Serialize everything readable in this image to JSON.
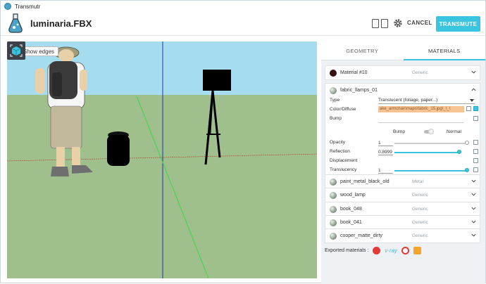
{
  "window": {
    "title": "Transmutr"
  },
  "header": {
    "filename": "luminaria.FBX",
    "cancel_label": "CANCEL",
    "transmute_label": "TRANSMUTE"
  },
  "viewport": {
    "show_edges_label": "Show edges",
    "show_edges_checked": false
  },
  "panel": {
    "tabs": [
      {
        "label": "GEOMETRY",
        "active": false
      },
      {
        "label": "MATERIALS",
        "active": true
      }
    ],
    "materials": [
      {
        "name": "Material #10",
        "type": "Generic",
        "swatch": "#3a0f10",
        "expanded": false
      },
      {
        "name": "fabric_llamps_01",
        "type": "",
        "swatch": "#6f8d6f",
        "expanded": true
      },
      {
        "name": "paint_metal_black_old",
        "type": "Metal",
        "swatch": "#557055",
        "expanded": false
      },
      {
        "name": "wood_lamp",
        "type": "Generic",
        "swatch": "#557055",
        "expanded": false
      },
      {
        "name": "book_048",
        "type": "Generic",
        "swatch": "#557055",
        "expanded": false
      },
      {
        "name": "book_041",
        "type": "Generic",
        "swatch": "#557055",
        "expanded": false
      },
      {
        "name": "cooper_matte_dirty",
        "type": "Generic",
        "swatch": "#557055",
        "expanded": false
      }
    ],
    "props": {
      "type_label": "Type",
      "type_value": "Translucent (foliage, paper...)",
      "diffuse_label": "Color/Diffuse",
      "diffuse_value": "ake_armchair\\maps\\fabric_15.jpg\\_\\_\\",
      "bump_label": "Bump",
      "bump_toggle_left": "Bump",
      "bump_toggle_right": "Normal",
      "opacity_label": "Opacity",
      "opacity_value": "1",
      "reflection_label": "Reflection",
      "reflection_value": "0.8999",
      "displacement_label": "Displacement",
      "translucency_label": "Translucency",
      "translucency_value": "1"
    },
    "exported_label": "Exported materials :",
    "exporters": [
      "sketchup-icon",
      "vray-icon",
      "thea-icon",
      "enscape-icon"
    ],
    "vray_text": "v·ray"
  },
  "colors": {
    "accent": "#3bc4df",
    "sky": "#a6dcef",
    "ground": "#9fbf8d"
  }
}
